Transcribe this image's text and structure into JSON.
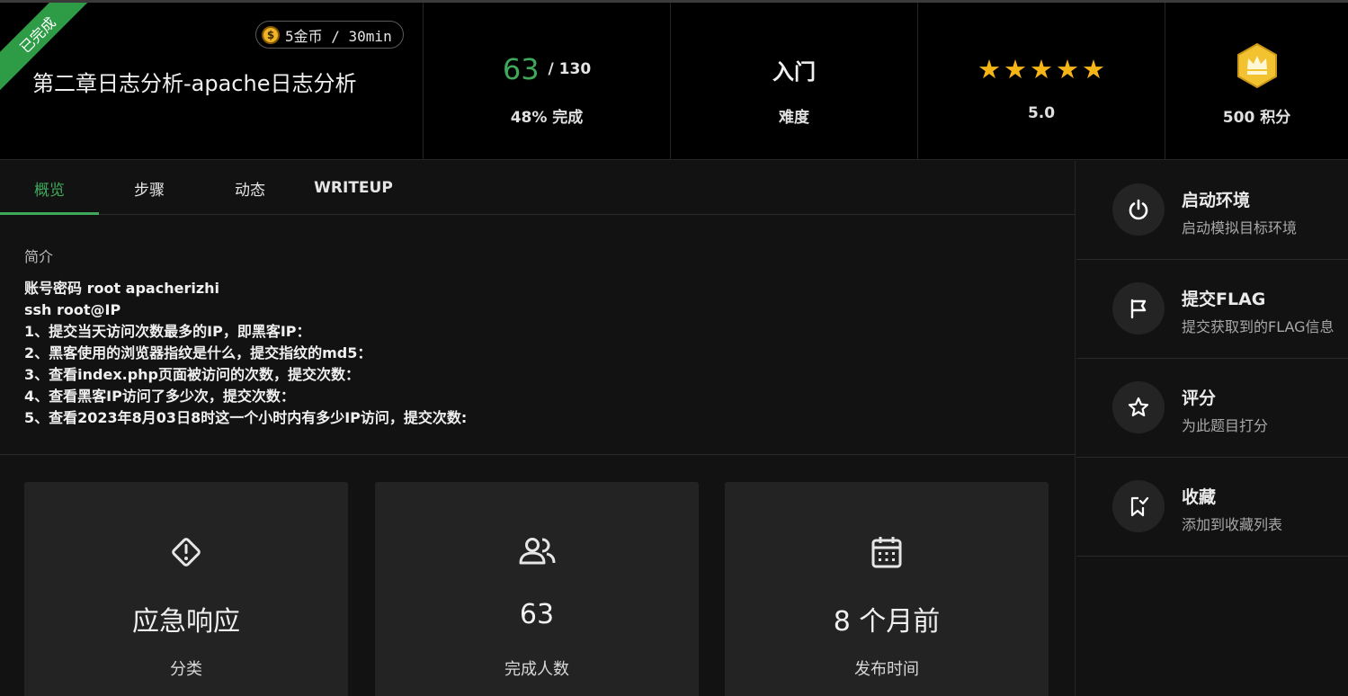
{
  "challenge": {
    "status_ribbon": "已完成",
    "reward": "5金币 / 30min",
    "coin_symbol": "$",
    "title": "第二章日志分析-apache日志分析"
  },
  "stats": {
    "progress": {
      "completed": "63",
      "total": "/ 130",
      "label": "48% 完成",
      "percent": 48
    },
    "difficulty": {
      "value": "入门",
      "label": "难度"
    },
    "rating": {
      "stars": 5,
      "value": "5.0"
    },
    "points": {
      "label": "500 积分",
      "icon": "crown-hexagon-icon"
    }
  },
  "tabs": [
    {
      "label": "概览",
      "active": true
    },
    {
      "label": "步骤",
      "active": false
    },
    {
      "label": "动态",
      "active": false
    },
    {
      "label": "WRITEUP",
      "active": false
    }
  ],
  "intro": {
    "heading": "简介",
    "lines": [
      "账号密码 root apacherizhi",
      "ssh root@IP",
      "1、提交当天访问次数最多的IP，即黑客IP：",
      "2、黑客使用的浏览器指纹是什么，提交指纹的md5：",
      "3、查看index.php页面被访问的次数，提交次数：",
      "4、查看黑客IP访问了多少次，提交次数：",
      "5、查看2023年8月03日8时这一个小时内有多少IP访问，提交次数:"
    ]
  },
  "cards": [
    {
      "icon": "warning-diamond-icon",
      "value": "应急响应",
      "label": "分类"
    },
    {
      "icon": "users-icon",
      "value": "63",
      "label": "完成人数"
    },
    {
      "icon": "calendar-icon",
      "value": "8 个月前",
      "label": "发布时间"
    }
  ],
  "sidebar": [
    {
      "icon": "power-icon",
      "title": "启动环境",
      "subtitle": "启动模拟目标环境"
    },
    {
      "icon": "flag-icon",
      "title": "提交FLAG",
      "subtitle": "提交获取到的FLAG信息"
    },
    {
      "icon": "star-outline-icon",
      "title": "评分",
      "subtitle": "为此题目打分"
    },
    {
      "icon": "bookmark-check-icon",
      "title": "收藏",
      "subtitle": "添加到收藏列表"
    }
  ],
  "colors": {
    "accent": "#3fa85a",
    "star": "#f5b516",
    "ribbon": "#2e9c47",
    "coin": "#f0b429",
    "crown": "#f2c230"
  }
}
